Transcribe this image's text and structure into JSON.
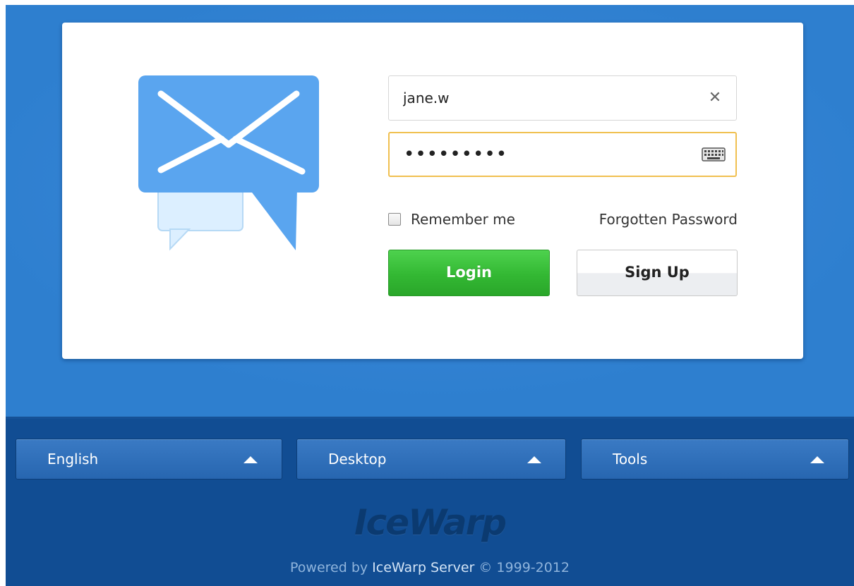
{
  "login": {
    "username_value": "jane.w",
    "password_value": "•••••••••",
    "remember_label": "Remember me",
    "forgot_label": "Forgotten Password",
    "login_label": "Login",
    "signup_label": "Sign Up"
  },
  "footer": {
    "dropdowns": [
      {
        "label": "English"
      },
      {
        "label": "Desktop"
      },
      {
        "label": "Tools"
      }
    ],
    "brand": "IceWarp",
    "powered_prefix": "Powered by ",
    "powered_product": "IceWarp Server",
    "powered_suffix": " © 1999-2012"
  },
  "colors": {
    "background": "#2e7fcf",
    "footer": "#114d93",
    "login_button": "#33b833",
    "focus_border": "#f0c050",
    "logo_blue": "#5aa5ef"
  },
  "icons": {
    "logo": "mail-envelope-speech-bubble-icon",
    "clear": "close-icon",
    "keyboard": "keyboard-icon",
    "caret": "caret-up-icon"
  }
}
